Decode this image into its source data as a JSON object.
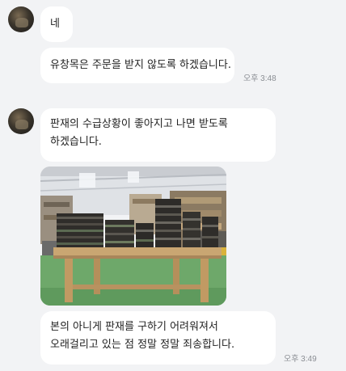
{
  "messages": [
    {
      "text": "네"
    },
    {
      "text": "유창목은 주문을 받지 않도록 하겠습니다.",
      "time": "오후 3:48"
    },
    {
      "text": "판재의 수급상황이 좋아지고 나면 받도록 하겠습니다."
    },
    {
      "text": "본의 아니게 판재를 구하기 어려워져서 오래걸리고 있는 점 정말 정말 죄송합니다.",
      "time": "오후 3:49"
    }
  ],
  "icons": {
    "avatar": "profile-avatar",
    "photo": "workshop-wood-stacks-photo"
  }
}
